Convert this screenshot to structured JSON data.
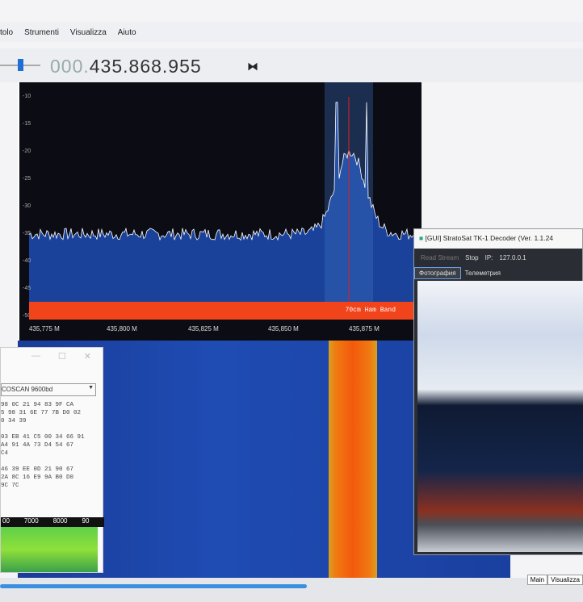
{
  "menu": [
    "tolo",
    "Strumenti",
    "Visualizza",
    "Aiuto"
  ],
  "frequency": {
    "prefix": "000.",
    "value": "435.868.955",
    "swap_icon": "swap-icon"
  },
  "spectrum": {
    "y_ticks": [
      "-10",
      "-15",
      "-20",
      "-25",
      "-30",
      "-35",
      "-40",
      "-45",
      "-50"
    ],
    "x_ticks": [
      "435,775 M",
      "435,800 M",
      "435,825 M",
      "435,850 M",
      "435,875 M"
    ],
    "band_label": "70cm Ham Band",
    "colors": {
      "band": "#f2441b",
      "trace": "#ffffff",
      "fill": "#1f4cb3",
      "marker": "#e02020"
    }
  },
  "left_window": {
    "mode": "COSCAN 9600bd",
    "hex": [
      "98 0C 21 94 83 9F CA",
      "5 98 31 6E 77 7B D0 02",
      "0 34 39",
      "",
      "03 EB 41 C5 00 34 66 91",
      "A4 91 4A 73 D4 54 67",
      "C4",
      "",
      "46 39 EE 0D 21 90 67",
      "2A 8C 16 E9 9A B0 D0",
      "9C 7C"
    ],
    "scale": [
      "00",
      "7000",
      "8000",
      "90"
    ]
  },
  "decoder": {
    "title": "[GUI] StratoSat TK-1 Decoder (Ver. 1.1.24",
    "read_stream": "Read Stream",
    "stop": "Stop",
    "ip_label": "IP:",
    "ip_value": "127.0.0.1",
    "tabs": [
      "Фотография",
      "Телеметрия"
    ]
  },
  "bottom_tabs": [
    "Main",
    "Visualizza"
  ]
}
